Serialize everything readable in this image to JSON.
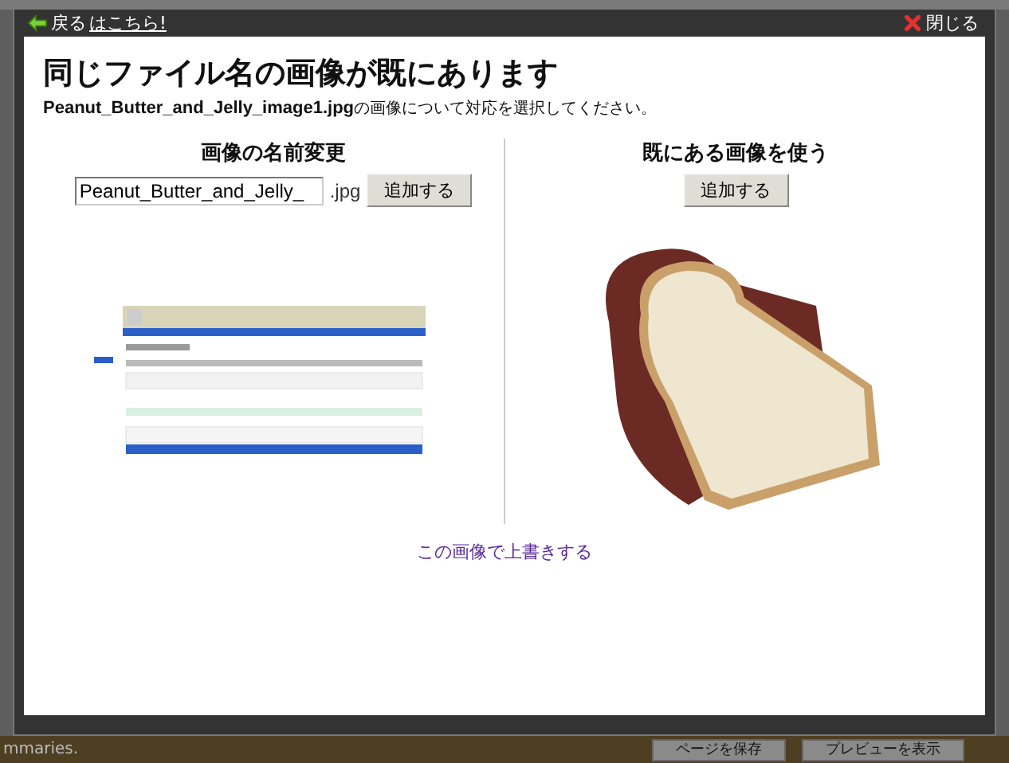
{
  "top_bar": {
    "back_label": "戻る",
    "link": "はこちら!",
    "close_label": "閉じる"
  },
  "dialog": {
    "title": "同じファイル名の画像が既にあります",
    "message": "**Peanut_Butter_and_Jelly_image1.jpg**の画像について対応を選択してください。"
  },
  "rename": {
    "heading": "画像の名前変更",
    "value": "Peanut_Butter_and_Jelly_",
    "extension": ".jpg",
    "button": "追加する"
  },
  "existing": {
    "heading": "既にある画像を使う",
    "button": "追加する"
  },
  "overwrite_link": "この画像で上書きする",
  "background": {
    "footer_text": "mmaries.",
    "buttons": [
      "ページを保存",
      "プレビューを表示"
    ]
  }
}
